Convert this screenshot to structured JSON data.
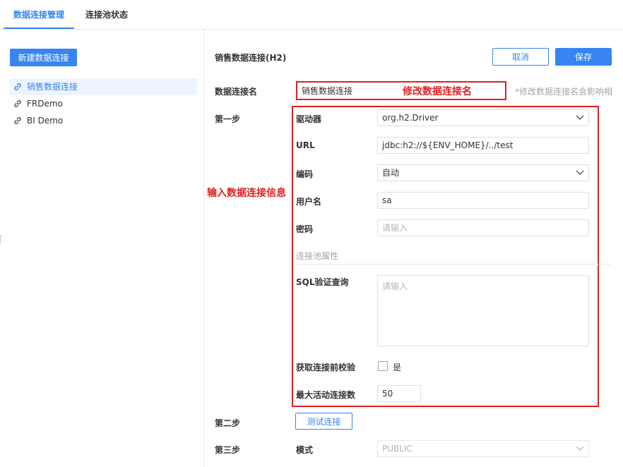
{
  "tabs": [
    {
      "label": "数据连接管理",
      "active": true
    },
    {
      "label": "连接池状态",
      "active": false
    }
  ],
  "sidebar": {
    "new_button": "新建数据连接",
    "items": [
      {
        "label": "销售数据连接",
        "selected": true,
        "icon": "link-icon"
      },
      {
        "label": "FRDemo",
        "selected": false,
        "icon": "link-icon"
      },
      {
        "label": "BI Demo",
        "selected": false,
        "icon": "link-icon"
      }
    ]
  },
  "header": {
    "title": "销售数据连接(H2)",
    "cancel_label": "取消",
    "save_label": "保存"
  },
  "form": {
    "name_label": "数据连接名",
    "name_value": "销售数据连接",
    "name_hint": "*修改数据连接名会影响相",
    "step1_label": "第一步",
    "driver_label": "驱动器",
    "driver_value": "org.h2.Driver",
    "url_label": "URL",
    "url_value": "jdbc:h2://${ENV_HOME}/../test",
    "encoding_label": "编码",
    "encoding_value": "自动",
    "username_label": "用户名",
    "username_value": "sa",
    "password_label": "密码",
    "password_placeholder": "请输入",
    "pool_section_label": "连接池属性",
    "sql_label": "SQL验证查询",
    "sql_placeholder": "请输入",
    "validate_label": "获取连接前校验",
    "validate_checkbox_label": "是",
    "validate_checked": false,
    "max_active_label": "最大活动连接数",
    "max_active_value": "50",
    "step2_label": "第二步",
    "test_button": "测试连接",
    "step3_label": "第三步",
    "mode_label": "模式",
    "mode_value": "PUBLIC"
  },
  "annotations": {
    "rename_note": "修改数据连接名",
    "input_info_note": "输入数据连接信息",
    "color": "#e02020"
  },
  "colors": {
    "accent": "#3685f2",
    "selected_bg": "#eef4fd",
    "border": "#dcdfe6"
  }
}
